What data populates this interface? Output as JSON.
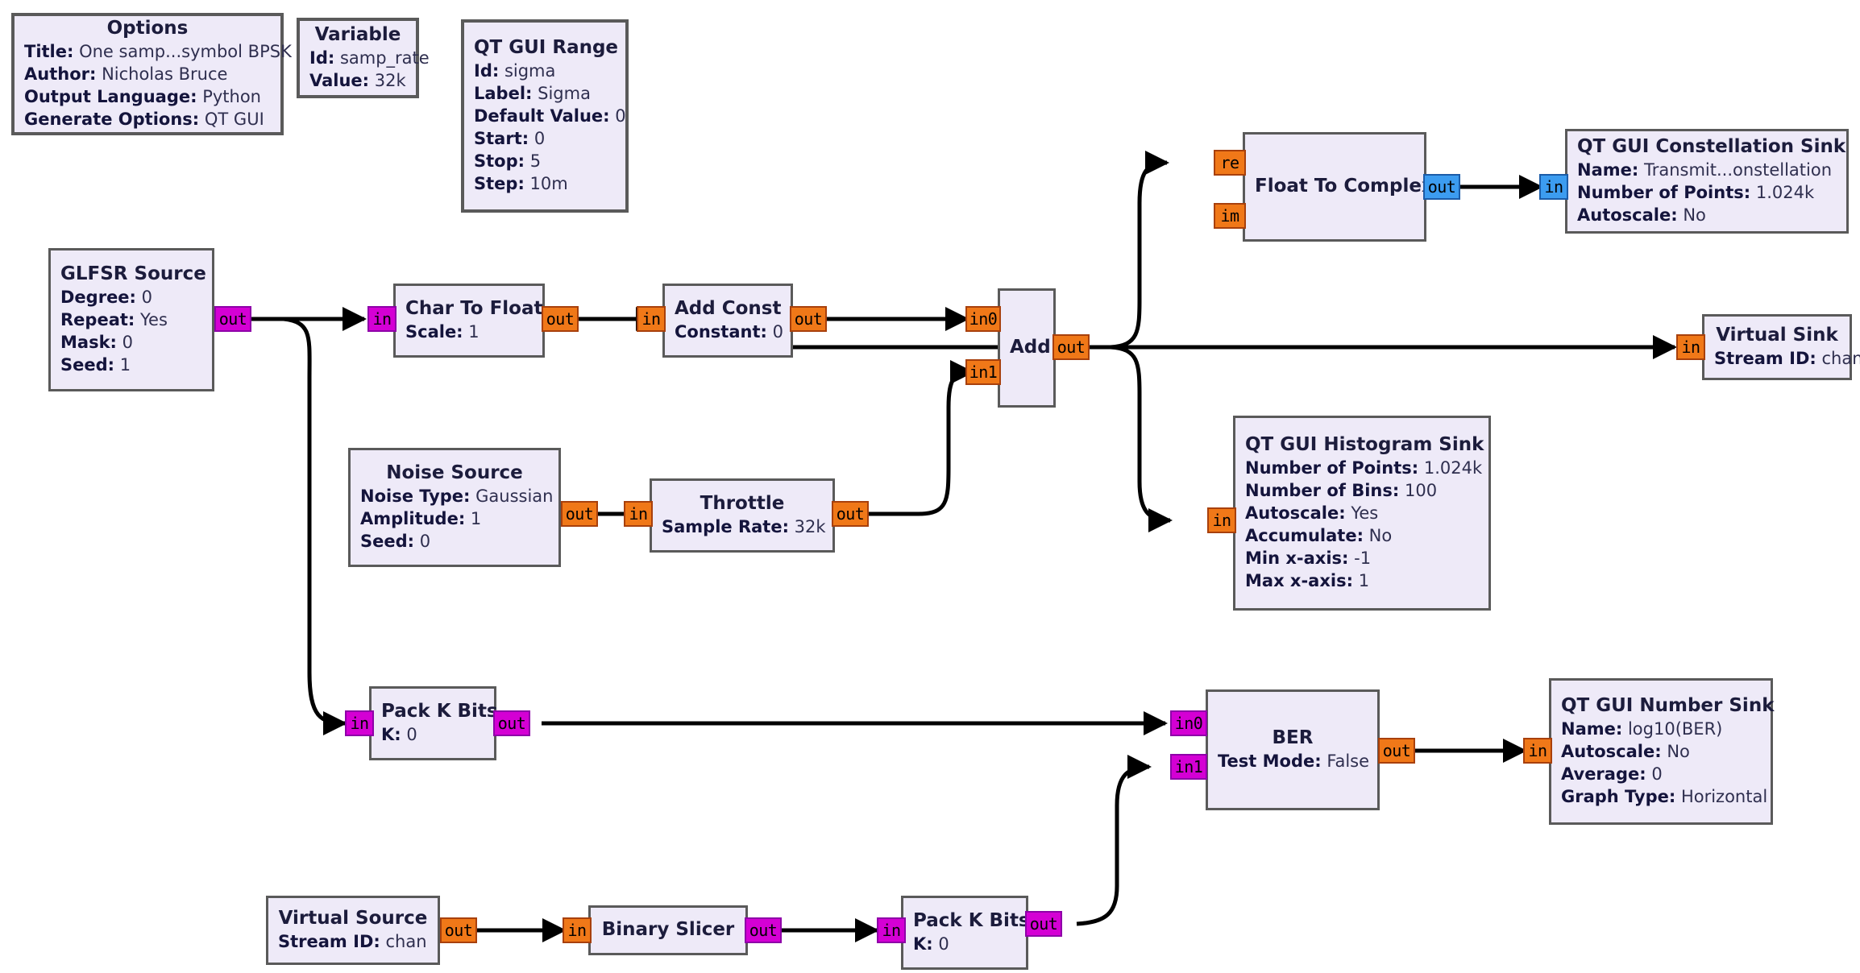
{
  "flowgraph": {
    "colors": {
      "block_fill": "#eeeaf8",
      "block_border": "#5a5a5a",
      "port_byte": "#d400d4",
      "port_float": "#f07818",
      "port_complex": "#3c9cf0",
      "wire": "#000000",
      "background": "#ffffff"
    },
    "blocks": [
      {
        "id": "options",
        "title": "Options",
        "params": [
          {
            "key": "Title:",
            "value": "One samp...symbol BPSK"
          },
          {
            "key": "Author:",
            "value": "Nicholas Bruce"
          },
          {
            "key": "Output Language:",
            "value": "Python"
          },
          {
            "key": "Generate Options:",
            "value": "QT GUI"
          }
        ]
      },
      {
        "id": "variable",
        "title": "Variable",
        "params": [
          {
            "key": "Id:",
            "value": "samp_rate"
          },
          {
            "key": "Value:",
            "value": "32k"
          }
        ]
      },
      {
        "id": "qt-gui-range",
        "title": "QT GUI Range",
        "params": [
          {
            "key": "Id:",
            "value": "sigma"
          },
          {
            "key": "Label:",
            "value": "Sigma"
          },
          {
            "key": "Default Value:",
            "value": "0"
          },
          {
            "key": "Start:",
            "value": "0"
          },
          {
            "key": "Stop:",
            "value": "5"
          },
          {
            "key": "Step:",
            "value": "10m"
          }
        ]
      },
      {
        "id": "glfsr-source",
        "title": "GLFSR Source",
        "params": [
          {
            "key": "Degree:",
            "value": "0"
          },
          {
            "key": "Repeat:",
            "value": "Yes"
          },
          {
            "key": "Mask:",
            "value": "0"
          },
          {
            "key": "Seed:",
            "value": "1"
          }
        ],
        "ports": [
          {
            "label": "out",
            "type": "byte"
          }
        ]
      },
      {
        "id": "char-to-float",
        "title": "Char To Float",
        "params": [
          {
            "key": "Scale:",
            "value": "1"
          }
        ],
        "ports": [
          {
            "label": "in",
            "type": "byte"
          },
          {
            "label": "out",
            "type": "float"
          }
        ]
      },
      {
        "id": "add-const",
        "title": "Add Const",
        "params": [
          {
            "key": "Constant:",
            "value": "0"
          }
        ],
        "ports": [
          {
            "label": "in",
            "type": "float"
          },
          {
            "label": "out",
            "type": "float"
          }
        ]
      },
      {
        "id": "add",
        "title": "Add",
        "params": [],
        "ports": [
          {
            "label": "in0",
            "type": "float"
          },
          {
            "label": "in1",
            "type": "float"
          },
          {
            "label": "out",
            "type": "float"
          }
        ]
      },
      {
        "id": "float-to-complex",
        "title": "Float To Complex",
        "params": [],
        "ports": [
          {
            "label": "re",
            "type": "float"
          },
          {
            "label": "im",
            "type": "float"
          },
          {
            "label": "out",
            "type": "complex"
          }
        ]
      },
      {
        "id": "qt-gui-constellation-sink",
        "title": "QT GUI Constellation Sink",
        "params": [
          {
            "key": "Name:",
            "value": "Transmit...onstellation"
          },
          {
            "key": "Number of Points:",
            "value": "1.024k"
          },
          {
            "key": "Autoscale:",
            "value": "No"
          }
        ],
        "ports": [
          {
            "label": "in",
            "type": "complex"
          }
        ]
      },
      {
        "id": "virtual-sink",
        "title": "Virtual Sink",
        "params": [
          {
            "key": "Stream ID:",
            "value": "chan"
          }
        ],
        "ports": [
          {
            "label": "in",
            "type": "float"
          }
        ]
      },
      {
        "id": "qt-gui-histogram-sink",
        "title": "QT GUI Histogram Sink",
        "params": [
          {
            "key": "Number of Points:",
            "value": "1.024k"
          },
          {
            "key": "Number of Bins:",
            "value": "100"
          },
          {
            "key": "Autoscale:",
            "value": "Yes"
          },
          {
            "key": "Accumulate:",
            "value": "No"
          },
          {
            "key": "Min x-axis:",
            "value": "-1"
          },
          {
            "key": "Max x-axis:",
            "value": "1"
          }
        ],
        "ports": [
          {
            "label": "in",
            "type": "float"
          }
        ]
      },
      {
        "id": "noise-source",
        "title": "Noise Source",
        "params": [
          {
            "key": "Noise Type:",
            "value": "Gaussian"
          },
          {
            "key": "Amplitude:",
            "value": "1"
          },
          {
            "key": "Seed:",
            "value": "0"
          }
        ],
        "ports": [
          {
            "label": "out",
            "type": "float"
          }
        ]
      },
      {
        "id": "throttle",
        "title": "Throttle",
        "params": [
          {
            "key": "Sample Rate:",
            "value": "32k"
          }
        ],
        "ports": [
          {
            "label": "in",
            "type": "float"
          },
          {
            "label": "out",
            "type": "float"
          }
        ]
      },
      {
        "id": "pack-k-bits-top",
        "title": "Pack K Bits",
        "params": [
          {
            "key": "K:",
            "value": "0"
          }
        ],
        "ports": [
          {
            "label": "in",
            "type": "byte"
          },
          {
            "label": "out",
            "type": "byte"
          }
        ]
      },
      {
        "id": "ber",
        "title": "BER",
        "params": [
          {
            "key": "Test Mode:",
            "value": "False"
          }
        ],
        "ports": [
          {
            "label": "in0",
            "type": "byte"
          },
          {
            "label": "in1",
            "type": "byte"
          },
          {
            "label": "out",
            "type": "float"
          }
        ]
      },
      {
        "id": "qt-gui-number-sink",
        "title": "QT GUI Number Sink",
        "params": [
          {
            "key": "Name:",
            "value": "log10(BER)"
          },
          {
            "key": "Autoscale:",
            "value": "No"
          },
          {
            "key": "Average:",
            "value": "0"
          },
          {
            "key": "Graph Type:",
            "value": "Horizontal"
          }
        ],
        "ports": [
          {
            "label": "in",
            "type": "float"
          }
        ]
      },
      {
        "id": "virtual-source",
        "title": "Virtual Source",
        "params": [
          {
            "key": "Stream ID:",
            "value": "chan"
          }
        ],
        "ports": [
          {
            "label": "out",
            "type": "float"
          }
        ]
      },
      {
        "id": "binary-slicer",
        "title": "Binary Slicer",
        "params": [],
        "ports": [
          {
            "label": "in",
            "type": "float"
          },
          {
            "label": "out",
            "type": "byte"
          }
        ]
      },
      {
        "id": "pack-k-bits-bottom",
        "title": "Pack K Bits",
        "params": [
          {
            "key": "K:",
            "value": "0"
          }
        ],
        "ports": [
          {
            "label": "in",
            "type": "byte"
          },
          {
            "label": "out",
            "type": "byte"
          }
        ]
      }
    ]
  },
  "options": {
    "title": "Options",
    "p": {
      "title_k": "Title:",
      "title_v": "One samp...symbol BPSK",
      "author_k": "Author:",
      "author_v": "Nicholas Bruce",
      "lang_k": "Output Language:",
      "lang_v": "Python",
      "gen_k": "Generate Options:",
      "gen_v": "QT GUI"
    }
  },
  "variable": {
    "title": "Variable",
    "p": {
      "id_k": "Id:",
      "id_v": "samp_rate",
      "val_k": "Value:",
      "val_v": "32k"
    }
  },
  "range": {
    "title": "QT GUI Range",
    "p": {
      "id_k": "Id:",
      "id_v": "sigma",
      "label_k": "Label:",
      "label_v": "Sigma",
      "def_k": "Default Value:",
      "def_v": "0",
      "start_k": "Start:",
      "start_v": "0",
      "stop_k": "Stop:",
      "stop_v": "5",
      "step_k": "Step:",
      "step_v": "10m"
    }
  },
  "glfsr": {
    "title": "GLFSR Source",
    "p": {
      "deg_k": "Degree:",
      "deg_v": "0",
      "rep_k": "Repeat:",
      "rep_v": "Yes",
      "mask_k": "Mask:",
      "mask_v": "0",
      "seed_k": "Seed:",
      "seed_v": "1"
    },
    "ports": {
      "out": "out"
    }
  },
  "char2float": {
    "title": "Char To Float",
    "p": {
      "scale_k": "Scale:",
      "scale_v": "1"
    },
    "ports": {
      "in": "in",
      "out": "out"
    }
  },
  "addconst": {
    "title": "Add Const",
    "p": {
      "const_k": "Constant:",
      "const_v": "0"
    },
    "ports": {
      "in": "in",
      "out": "out"
    }
  },
  "add": {
    "title": "Add",
    "ports": {
      "in0": "in0",
      "in1": "in1",
      "out": "out"
    }
  },
  "f2c": {
    "title": "Float To Complex",
    "ports": {
      "re": "re",
      "im": "im",
      "out": "out"
    }
  },
  "constsink": {
    "title": "QT GUI Constellation Sink",
    "p": {
      "name_k": "Name:",
      "name_v": "Transmit...onstellation",
      "pts_k": "Number of Points:",
      "pts_v": "1.024k",
      "auto_k": "Autoscale:",
      "auto_v": "No"
    },
    "ports": {
      "in": "in"
    }
  },
  "vsink": {
    "title": "Virtual Sink",
    "p": {
      "sid_k": "Stream ID:",
      "sid_v": "chan"
    },
    "ports": {
      "in": "in"
    }
  },
  "histsink": {
    "title": "QT GUI Histogram Sink",
    "p": {
      "pts_k": "Number of Points:",
      "pts_v": "1.024k",
      "bins_k": "Number of Bins:",
      "bins_v": "100",
      "auto_k": "Autoscale:",
      "auto_v": "Yes",
      "acc_k": "Accumulate:",
      "acc_v": "No",
      "min_k": "Min x-axis:",
      "min_v": "-1",
      "max_k": "Max x-axis:",
      "max_v": "1"
    },
    "ports": {
      "in": "in"
    }
  },
  "noise": {
    "title": "Noise Source",
    "p": {
      "type_k": "Noise Type:",
      "type_v": "Gaussian",
      "amp_k": "Amplitude:",
      "amp_v": "1",
      "seed_k": "Seed:",
      "seed_v": "0"
    },
    "ports": {
      "out": "out"
    }
  },
  "throttle": {
    "title": "Throttle",
    "p": {
      "sr_k": "Sample Rate:",
      "sr_v": "32k"
    },
    "ports": {
      "in": "in",
      "out": "out"
    }
  },
  "packtop": {
    "title": "Pack K Bits",
    "p": {
      "k_k": "K:",
      "k_v": "0"
    },
    "ports": {
      "in": "in",
      "out": "out"
    }
  },
  "ber": {
    "title": "BER",
    "p": {
      "tm_k": "Test Mode:",
      "tm_v": "False"
    },
    "ports": {
      "in0": "in0",
      "in1": "in1",
      "out": "out"
    }
  },
  "numsink": {
    "title": "QT GUI Number Sink",
    "p": {
      "name_k": "Name:",
      "name_v": "log10(BER)",
      "auto_k": "Autoscale:",
      "auto_v": "No",
      "avg_k": "Average:",
      "avg_v": "0",
      "gt_k": "Graph Type:",
      "gt_v": "Horizontal"
    },
    "ports": {
      "in": "in"
    }
  },
  "vsource": {
    "title": "Virtual Source",
    "p": {
      "sid_k": "Stream ID:",
      "sid_v": "chan"
    },
    "ports": {
      "out": "out"
    }
  },
  "slicer": {
    "title": "Binary Slicer",
    "ports": {
      "in": "in",
      "out": "out"
    }
  },
  "packbot": {
    "title": "Pack K Bits",
    "p": {
      "k_k": "K:",
      "k_v": "0"
    },
    "ports": {
      "in": "in",
      "out": "out"
    }
  }
}
